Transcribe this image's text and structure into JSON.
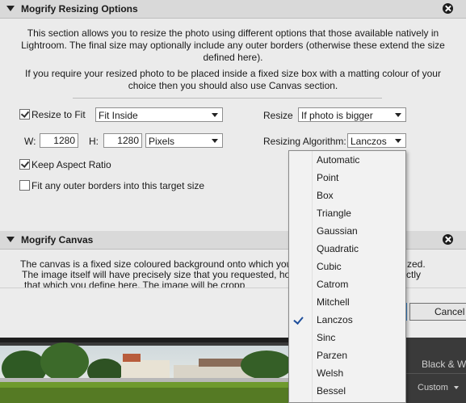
{
  "resize_section": {
    "title": "Mogrify Resizing Options",
    "desc1_lines": [
      "This section allows you to resize the photo using different options that those available natively in",
      "Lightroom. The final size may optionally include any outer borders (otherwise these extend the size",
      "defined here)."
    ],
    "desc2_lines": [
      "If you require your resized photo to be placed inside a fixed size box with a matting colour of your",
      "choice then you should also use Canvas section."
    ],
    "resize_to_fit_label": "Resize to Fit",
    "fit_mode_value": "Fit Inside",
    "resize_label": "Resize",
    "resize_condition_value": "If photo is bigger",
    "w_label": "W:",
    "w_value": "1280",
    "h_label": "H:",
    "h_value": "1280",
    "units_value": "Pixels",
    "algorithm_label": "Resizing Algorithm:",
    "algorithm_value": "Lanczos",
    "keep_aspect_label": "Keep Aspect Ratio",
    "fit_borders_label": "Fit any outer borders into this target size",
    "resize_to_fit_checked": true,
    "keep_aspect_checked": true,
    "fit_borders_checked": false
  },
  "canvas_section": {
    "title": "Mogrify Canvas",
    "line1": "The canvas is a fixed size coloured background onto which your final i",
    "line1_tail": "zed.",
    "line2": "The image itself will have precisely size that you requested, however",
    "line2_tail": "ctly",
    "line3": "that which you define here. The image will be cropp"
  },
  "footer": {
    "cancel_label": "Cancel"
  },
  "background_panel": {
    "tab_label": "Black & Wh",
    "custom_label": "Custom"
  },
  "algorithm_dropdown": {
    "selected": "Lanczos",
    "options": [
      "Automatic",
      "Point",
      "Box",
      "Triangle",
      "Gaussian",
      "Quadratic",
      "Cubic",
      "Catrom",
      "Mitchell",
      "Lanczos",
      "Sinc",
      "Parzen",
      "Welsh",
      "Bessel"
    ]
  }
}
